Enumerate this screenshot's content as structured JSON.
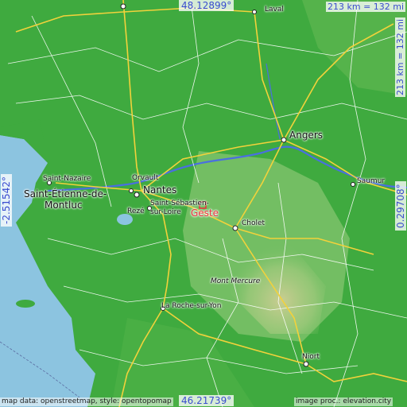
{
  "map": {
    "focus_place": "Geste",
    "latitude_top": "48.12899°",
    "latitude_bottom": "46.21739°",
    "longitude_left": "-2.51542°",
    "longitude_right": "0.29708°",
    "scale_horizontal": "213 km = 132 mi",
    "scale_vertical": "213 km = 132 mi",
    "attribution_left": "map data: openstreetmap, style: opentopomap",
    "attribution_right": "image proc.: elevation.city",
    "places": {
      "laval": "Laval",
      "angers": "Angers",
      "saumur": "Saumur",
      "saint_nazaire": "Saint-Nazaire",
      "saint_etienne_1": "Saint-Étienne-de-",
      "saint_etienne_2": "Montluc",
      "orvault": "Orvault",
      "nantes": "Nantes",
      "reze": "Rezé",
      "saint_sebastien_1": "Saint-Sébastien-",
      "saint_sebastien_2": "sur-Loire",
      "cholet": "Cholet",
      "mont_mercure": "Mont Mercure",
      "la_roche": "La Roche-sur-Yon",
      "niort": "Niort"
    },
    "colors": {
      "lowland_green": "#3faa3f",
      "light_green": "#7cc26a",
      "sea": "#8cc4e0",
      "hill_tan": "#d9cf9a",
      "road_major": "#f2d23b",
      "road_minor": "#ffffff",
      "river": "#4a6fe0",
      "label_accent": "#3a4ccf",
      "focus_marker": "#e8323c"
    }
  }
}
